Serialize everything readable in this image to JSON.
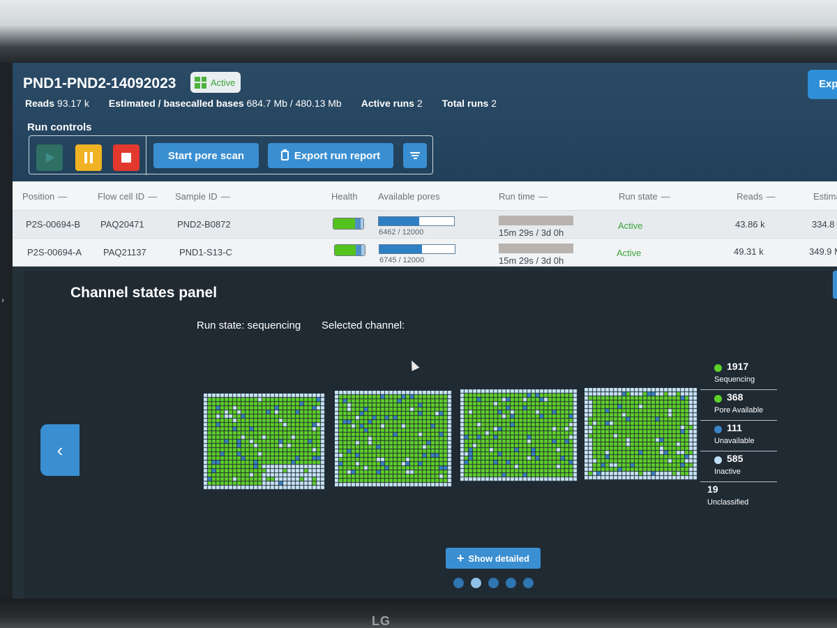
{
  "experiment": {
    "title": "PND1-PND2-14092023",
    "status": "Active",
    "export_label": "Exp",
    "stats": [
      {
        "label": "Reads",
        "value": "93.17 k"
      },
      {
        "label": "Estimated / basecalled bases",
        "value": "684.7 Mb / 480.13 Mb"
      },
      {
        "label": "Active runs",
        "value": "2"
      },
      {
        "label": "Total runs",
        "value": "2"
      }
    ]
  },
  "run_controls": {
    "title": "Run controls",
    "start_pore_scan": "Start pore scan",
    "export_run_report": "Export run report"
  },
  "table": {
    "headers": {
      "position": "Position",
      "flow_cell_id": "Flow cell ID",
      "sample_id": "Sample ID",
      "health": "Health",
      "available_pores": "Available pores",
      "run_time": "Run time",
      "run_state": "Run state",
      "reads": "Reads",
      "estimated": "Estima",
      "dash": "—"
    },
    "rows": [
      {
        "position": "P2S-00694-B",
        "flow_cell_id": "PAQ20471",
        "sample_id": "PND2-B0872",
        "pores": "6462 / 12000",
        "pores_fraction": 0.5385,
        "run_time": "15m 29s / 3d 0h",
        "run_state": "Active",
        "reads": "43.86 k",
        "estimated": "334.8",
        "health": {
          "green": 0.72,
          "blue": 0.18,
          "light": 0.1
        }
      },
      {
        "position": "P2S-00694-A",
        "flow_cell_id": "PAQ21137",
        "sample_id": "PND1-S13-C",
        "pores": "6745 / 12000",
        "pores_fraction": 0.5621,
        "run_time": "15m 29s / 3d 0h",
        "run_state": "Active",
        "reads": "49.31 k",
        "estimated": "349.9 M",
        "health": {
          "green": 0.7,
          "blue": 0.18,
          "light": 0.12
        }
      }
    ]
  },
  "channel_panel": {
    "title": "Channel states panel",
    "run_state": "Run state: sequencing",
    "selected_channel": "Selected channel:",
    "show_detailed": "Show detailed",
    "legend": [
      {
        "count": "1917",
        "label": "Sequencing",
        "color": "#5fd12a"
      },
      {
        "count": "368",
        "label": "Pore Available",
        "color": "#5fd12a"
      },
      {
        "count": "111",
        "label": "Unavailable",
        "color": "#3a84c7"
      },
      {
        "count": "585",
        "label": "Inactive",
        "color": "#bfe0f5"
      },
      {
        "count": "19",
        "label": "Unclassified",
        "color": null
      }
    ],
    "pages": 5,
    "current_page": 2
  },
  "colors": {
    "sequencing": "#5fd12a",
    "unavailable": "#3a84c7",
    "inactive": "#c9e5f7",
    "accent": "#3a8fd2"
  },
  "brand": "LG"
}
